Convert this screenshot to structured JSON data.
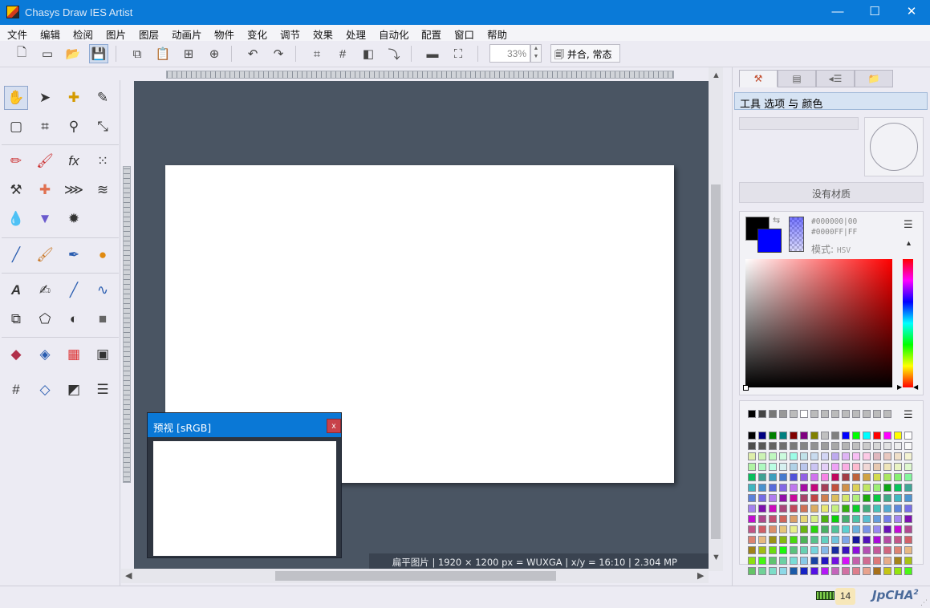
{
  "window": {
    "title": "Chasys Draw IES Artist",
    "controls": [
      "—",
      "☐",
      "✕"
    ]
  },
  "menu": [
    "文件",
    "编辑",
    "检阅",
    "图片",
    "图层",
    "动画片",
    "物件",
    "变化",
    "调节",
    "效果",
    "处理",
    "自动化",
    "配置",
    "窗口",
    "帮助"
  ],
  "toolbar": {
    "zoom_value": "33%",
    "fit_label": "并合, 常态"
  },
  "canvas": {
    "image_info": "扁平图片 | 1920 × 1200 px = WUXGA | x/y = 16:10 | 2.304 MP"
  },
  "preview": {
    "title": "预视 [sRGB]",
    "close": "x"
  },
  "right_panel": {
    "title": "工具 选项 与 颜色",
    "no_material": "没有材质",
    "fg_hex": "#000000|00",
    "bg_hex": "#0000FF|FF",
    "mode_label": "模式:",
    "mode_value": "HSV",
    "colors": {
      "foreground": "#000000",
      "background": "#0000FF"
    }
  },
  "status": {
    "count": "14",
    "brand": "JpCHA",
    "brand_sup": "2"
  }
}
